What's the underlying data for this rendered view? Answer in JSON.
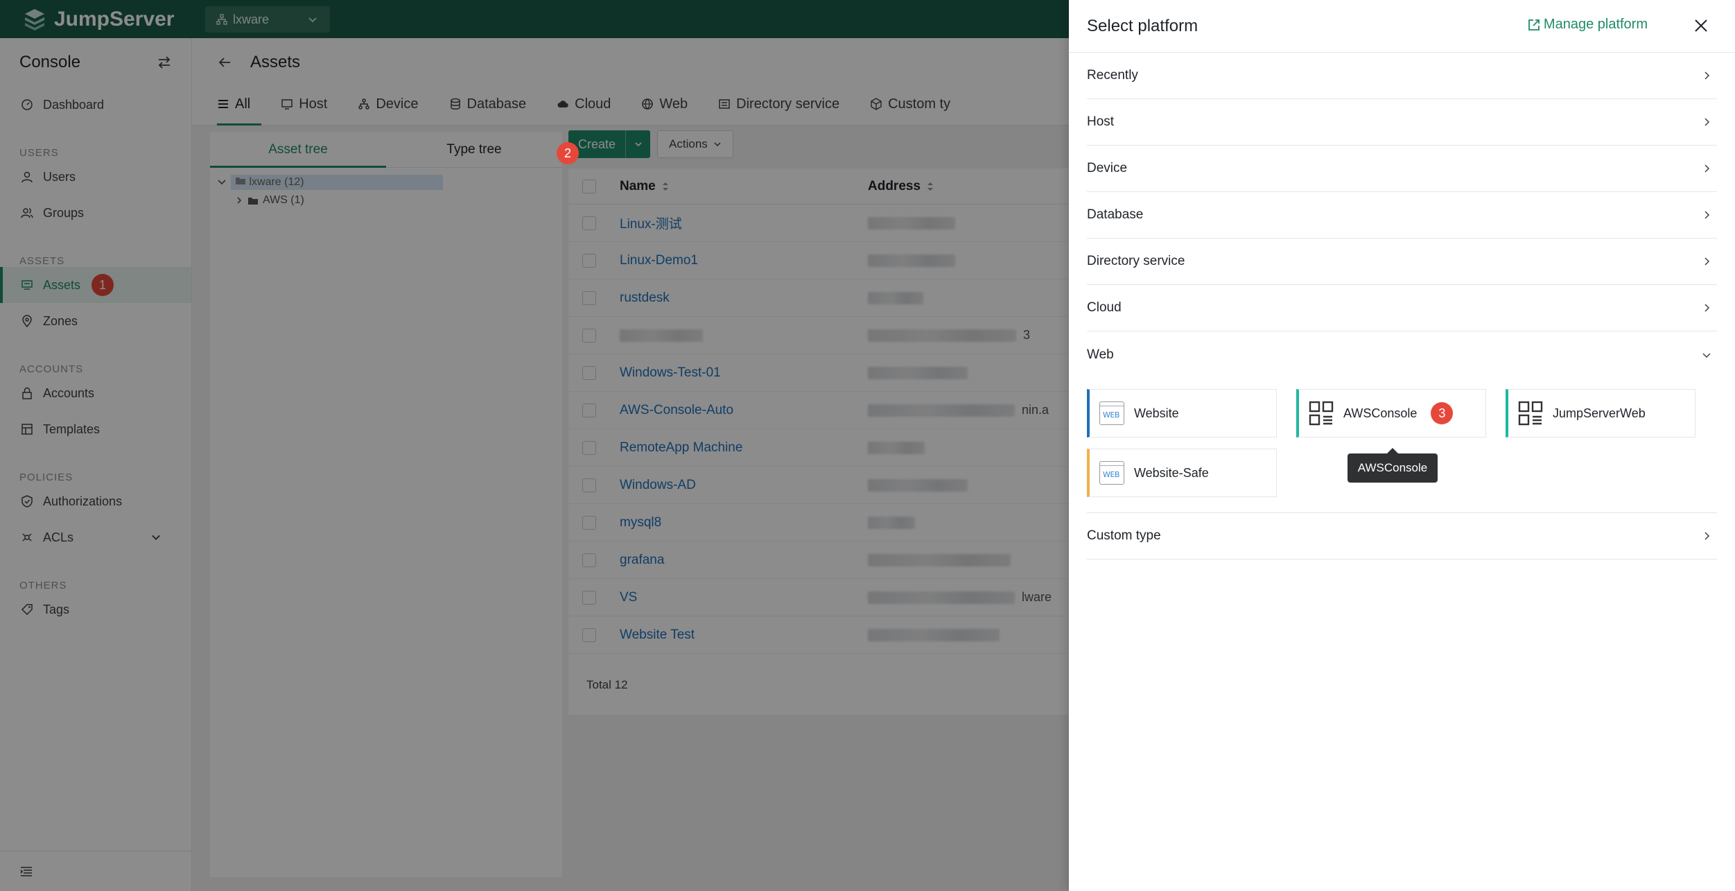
{
  "topbar": {
    "brand": "JumpServer",
    "org": "lxware"
  },
  "sidebar": {
    "title": "Console",
    "sections": {
      "users": "USERS",
      "assets": "ASSETS",
      "accounts": "ACCOUNTS",
      "policies": "POLICIES",
      "others": "OTHERS"
    },
    "items": {
      "dashboard": "Dashboard",
      "users": "Users",
      "groups": "Groups",
      "assets": "Assets",
      "zones": "Zones",
      "accounts": "Accounts",
      "templates": "Templates",
      "authorizations": "Authorizations",
      "acls": "ACLs",
      "tags": "Tags"
    }
  },
  "main": {
    "title": "Assets",
    "tabs": [
      "All",
      "Host",
      "Device",
      "Database",
      "Cloud",
      "Web",
      "Directory service",
      "Custom ty"
    ],
    "tree_tabs": {
      "asset_tree": "Asset tree",
      "type_tree": "Type tree"
    },
    "tree": {
      "root": "lxware (12)",
      "child": "AWS (1)"
    },
    "toolbar": {
      "create": "Create",
      "actions": "Actions"
    },
    "table": {
      "headers": {
        "name": "Name",
        "address": "Address"
      },
      "rows": [
        {
          "name": "Linux-测试",
          "addr_suffix": ""
        },
        {
          "name": "Linux-Demo1",
          "addr_suffix": ""
        },
        {
          "name": "rustdesk",
          "addr_suffix": ""
        },
        {
          "name": "",
          "addr_suffix": "3"
        },
        {
          "name": "Windows-Test-01",
          "addr_suffix": ""
        },
        {
          "name": "AWS-Console-Auto",
          "addr_suffix": "nin.a"
        },
        {
          "name": "RemoteApp Machine",
          "addr_suffix": ""
        },
        {
          "name": "Windows-AD",
          "addr_suffix": ""
        },
        {
          "name": "mysql8",
          "addr_suffix": ""
        },
        {
          "name": "grafana",
          "addr_suffix": ""
        },
        {
          "name": "VS",
          "addr_suffix": "lware"
        },
        {
          "name": "Website Test",
          "addr_suffix": ""
        }
      ],
      "total": "Total 12"
    }
  },
  "badges": {
    "one": "1",
    "two": "2",
    "three": "3"
  },
  "drawer": {
    "title": "Select platform",
    "manage": "Manage platform",
    "categories": {
      "recently": "Recently",
      "host": "Host",
      "device": "Device",
      "database": "Database",
      "directory": "Directory service",
      "cloud": "Cloud",
      "web": "Web",
      "custom": "Custom type"
    },
    "web_platforms": {
      "website": "Website",
      "awsconsole": "AWSConsole",
      "jumpserverweb": "JumpServerWeb",
      "website_safe": "Website-Safe"
    },
    "tooltip": "AWSConsole",
    "web_icon_text": "WEB"
  },
  "colors": {
    "brand": "#1a5c48",
    "accent": "#1f8a6a",
    "link": "#1f6fb8",
    "badge": "#e5483a"
  }
}
